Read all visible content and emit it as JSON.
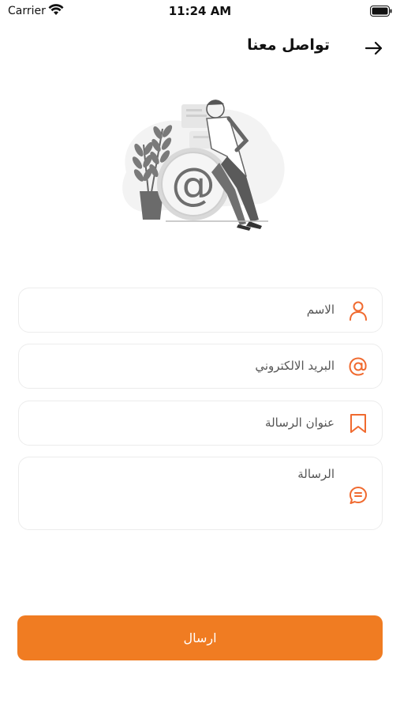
{
  "status_bar": {
    "carrier": "Carrier",
    "time": "11:24 AM"
  },
  "header": {
    "title": "تواصل معنا",
    "back_icon": "arrow-right-icon"
  },
  "illustration": {
    "icon": "email-at-illustration"
  },
  "form": {
    "name_placeholder": "الاسم",
    "email_placeholder": "البريد الالكتروني",
    "subject_placeholder": "عنوان الرسالة",
    "message_placeholder": "الرسالة",
    "icons": {
      "name": "user-icon",
      "email": "at-sign-icon",
      "subject": "bookmark-icon",
      "message": "chat-icon"
    }
  },
  "submit": {
    "label": "ارسال"
  },
  "colors": {
    "accent": "#f07c22",
    "field_border": "#ececec",
    "icon": "#f06a2f"
  }
}
